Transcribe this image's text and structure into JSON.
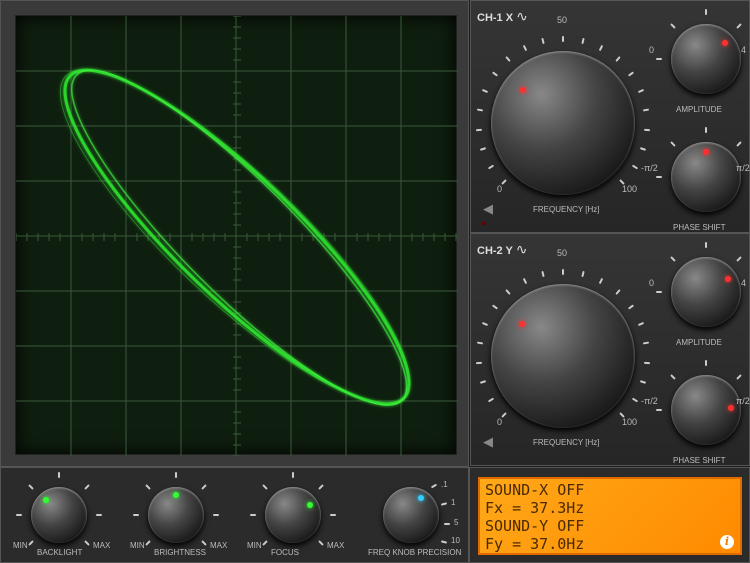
{
  "ch1": {
    "title": "CH-1 X",
    "freq_label": "FREQUENCY [Hz]",
    "freq_min": "0",
    "freq_mid": "50",
    "freq_max": "100",
    "amp_label": "AMPLITUDE",
    "amp_min": "0",
    "amp_max": "4",
    "phase_label": "PHASE SHIFT",
    "phase_min": "-π/2",
    "phase_max": "π/2"
  },
  "ch2": {
    "title": "CH-2 Y",
    "freq_label": "FREQUENCY [Hz]",
    "freq_min": "0",
    "freq_mid": "50",
    "freq_max": "100",
    "amp_label": "AMPLITUDE",
    "amp_min": "0",
    "amp_max": "4",
    "phase_label": "PHASE SHIFT",
    "phase_min": "-π/2",
    "phase_max": "π/2"
  },
  "bottom": {
    "backlight": "BACKLIGHT",
    "brightness": "BRIGHTNESS",
    "focus": "FOCUS",
    "precision": "FREQ KNOB PRECISION",
    "min": "MIN",
    "max": "MAX",
    "precision_opts": [
      ".1",
      "1",
      "5",
      "10"
    ]
  },
  "lcd": {
    "line1": "SOUND-X OFF",
    "line2": "Fx = 37.3Hz",
    "line3": "SOUND-Y OFF",
    "line4": "Fy = 37.0Hz",
    "info": "i"
  },
  "colors": {
    "trace": "#33ff33",
    "led_red": "#ff3030",
    "led_green": "#30ff30",
    "led_cyan": "#30d0ff",
    "lcd": "#ff9a00"
  }
}
